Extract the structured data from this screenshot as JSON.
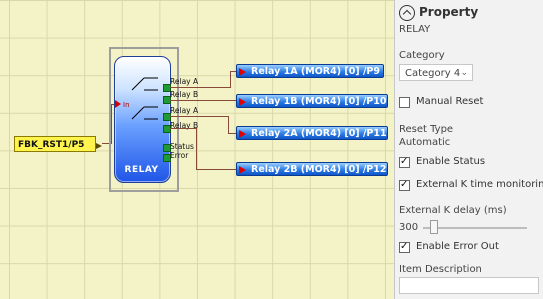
{
  "diagram": {
    "input_block": {
      "label": "FBK_RST1/P5"
    },
    "relay_block": {
      "title": "RELAY",
      "in_label": "In",
      "ports": [
        "Relay A",
        "Relay B",
        "Relay A",
        "Relay B",
        "Status",
        "Error"
      ]
    },
    "outputs": [
      "Relay 1A (MOR4) [0] /P9",
      "Relay 1B (MOR4) [0] /P10",
      "Relay 2A (MOR4) [0] /P11",
      "Relay 2B (MOR4) [0] /P12"
    ]
  },
  "panel": {
    "header": "Property",
    "subtitle": "RELAY",
    "category_label": "Category",
    "category_value": "Category 4",
    "manual_reset_label": "Manual Reset",
    "manual_reset_checked": false,
    "reset_type_label": "Reset Type",
    "reset_type_value": "Automatic",
    "enable_status_label": "Enable Status",
    "enable_status_checked": true,
    "external_k_label": "External K time monitoring",
    "external_k_checked": true,
    "external_k_delay_label": "External K delay (ms)",
    "external_k_delay_value": "300",
    "enable_error_out_label": "Enable Error Out",
    "enable_error_out_checked": true,
    "item_description_label": "Item Description",
    "item_description_value": ""
  },
  "colors": {
    "canvas_bg": "#f4f3c8",
    "grid": "#d9d8a7",
    "wire": "#8a4a3a",
    "output_block": "#2f7de5",
    "input_block": "#fff44d",
    "port": "#1e9b33"
  }
}
